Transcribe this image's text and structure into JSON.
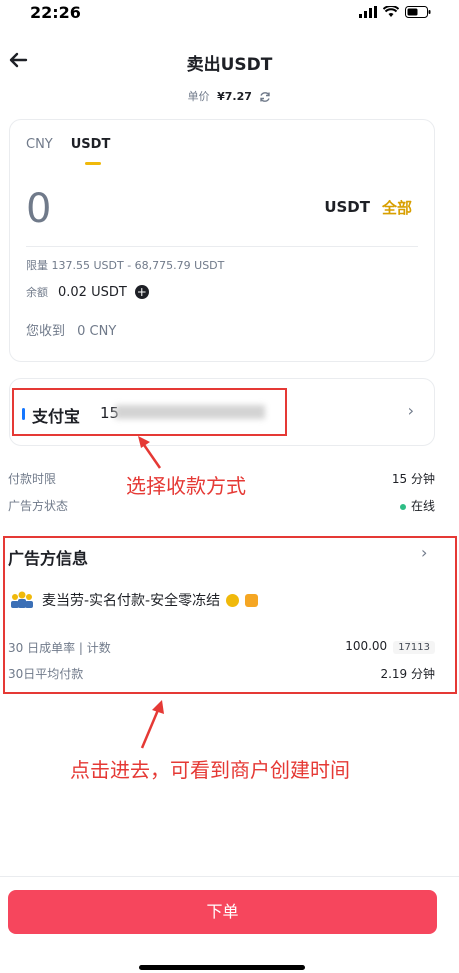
{
  "status_bar": {
    "time": "22:26"
  },
  "header": {
    "title": "卖出USDT"
  },
  "price": {
    "label": "单价",
    "value": "¥7.27"
  },
  "trade_card": {
    "tabs": [
      "CNY",
      "USDT"
    ],
    "active_tab": "USDT",
    "amount": "0",
    "unit": "USDT",
    "all_label": "全部",
    "limit_label": "限量",
    "limit_value": "137.55 USDT - 68,775.79 USDT",
    "balance_label": "余额",
    "balance_value": "0.02 USDT",
    "receive_label": "您收到",
    "receive_value": "0 CNY"
  },
  "payment": {
    "method": "支付宝",
    "account_prefix": "15",
    "account_suffix": "@"
  },
  "annotations": {
    "payment_note": "选择收款方式",
    "merchant_note": "点击进去，可看到商户创建时间"
  },
  "payment_info": {
    "time_limit_label": "付款时限",
    "time_limit_value": "15 分钟",
    "ad_status_label": "广告方状态",
    "ad_status_value": "在线"
  },
  "advertiser": {
    "section_title": "广告方信息",
    "name": "麦当劳-实名付款-安全零冻结",
    "completion_label": "30 日成单率 | 计数",
    "completion_rate": "100.00",
    "order_count": "17113",
    "avg_pay_label": "30日平均付款",
    "avg_pay_value": "2.19 分钟"
  },
  "actions": {
    "order_label": "下单"
  },
  "colors": {
    "accent": "#f0b90b",
    "sell": "#f6465d",
    "online": "#2ebd85",
    "annotation": "#e53935"
  }
}
